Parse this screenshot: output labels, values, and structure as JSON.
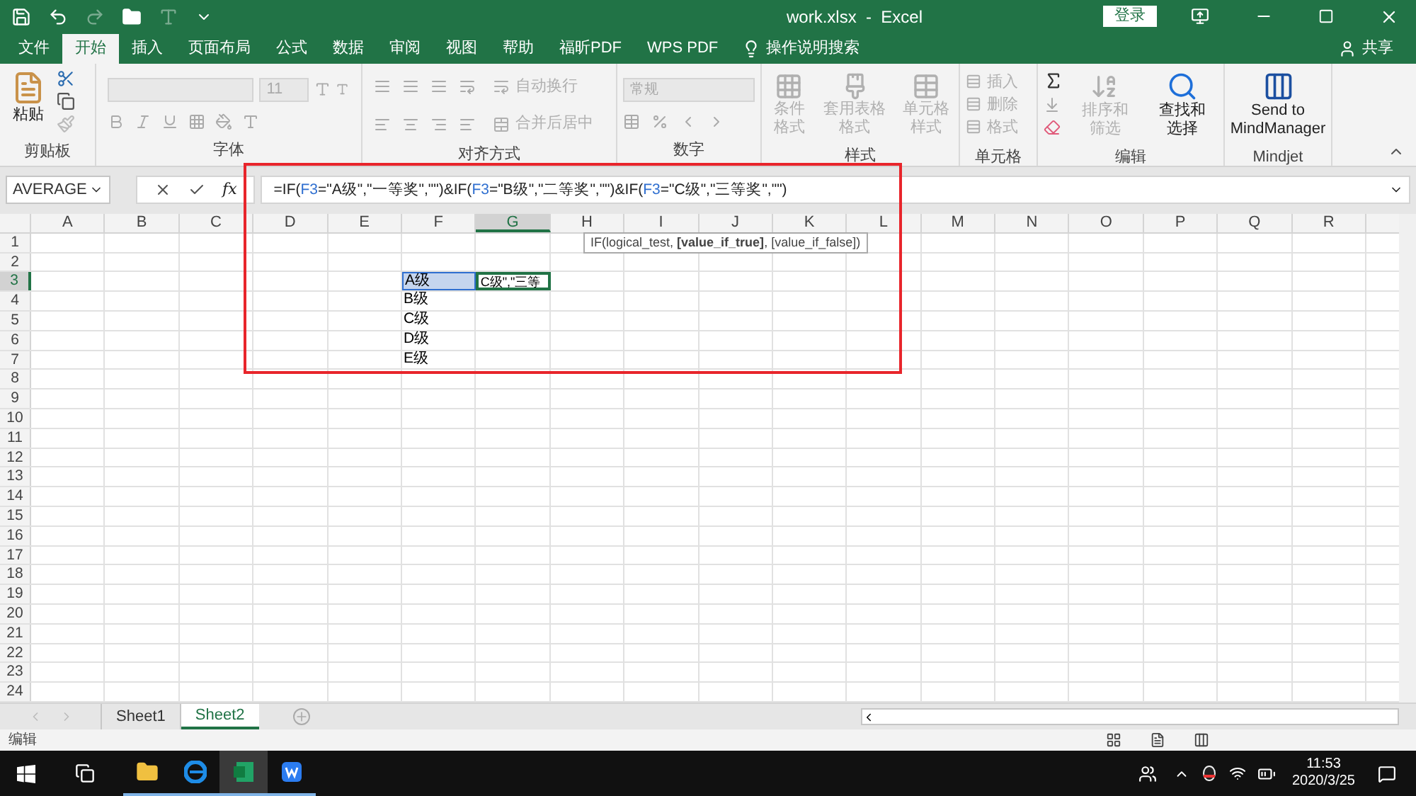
{
  "title_bar": {
    "title": "work.xlsx  -  Excel",
    "login": "登录"
  },
  "menu_tabs": [
    {
      "label": "文件",
      "selected": false
    },
    {
      "label": "开始",
      "selected": true
    },
    {
      "label": "插入",
      "selected": false
    },
    {
      "label": "页面布局",
      "selected": false
    },
    {
      "label": "公式",
      "selected": false
    },
    {
      "label": "数据",
      "selected": false
    },
    {
      "label": "审阅",
      "selected": false
    },
    {
      "label": "视图",
      "selected": false
    },
    {
      "label": "帮助",
      "selected": false
    },
    {
      "label": "福昕PDF",
      "selected": false
    },
    {
      "label": "WPS PDF",
      "selected": false
    }
  ],
  "tell_me": "操作说明搜索",
  "share": "共享",
  "ribbon": {
    "clipboard": {
      "label": "剪贴板",
      "paste": {
        "label": "粘贴",
        "disabled": false
      }
    },
    "font": {
      "label": "字体",
      "size": "11"
    },
    "alignment": {
      "label": "对齐方式",
      "commands": [
        {
          "label": "自动换行",
          "disabled": true
        },
        {
          "label": "合并后居中",
          "disabled": true
        }
      ]
    },
    "number": {
      "label": "数字",
      "format": "常规"
    },
    "styles": {
      "label": "样式",
      "commands": [
        {
          "label": "条件格式",
          "disabled": true
        },
        {
          "label": "套用表格格式",
          "disabled": true
        },
        {
          "label": "单元格样式",
          "disabled": true
        }
      ]
    },
    "cells": {
      "label": "单元格",
      "commands": [
        {
          "label": "插入",
          "disabled": true
        },
        {
          "label": "删除",
          "disabled": true
        },
        {
          "label": "格式",
          "disabled": true
        }
      ]
    },
    "editing": {
      "label": "编辑",
      "commands": [
        {
          "label": "排序和筛选",
          "disabled": true
        },
        {
          "label": "查找和选择",
          "disabled": false
        }
      ]
    },
    "mindjet": {
      "label": "Mindjet",
      "command": {
        "label": "Send to MindManager",
        "disabled": false
      }
    }
  },
  "formula_bar": {
    "name_box": "AVERAGE",
    "fx": "fx",
    "segments": [
      {
        "text": "=IF(",
        "kind": "text"
      },
      {
        "text": "F3",
        "kind": "ref"
      },
      {
        "text": "=\"A级\",\"一等奖\",\"\")&IF(",
        "kind": "text"
      },
      {
        "text": "F3",
        "kind": "ref"
      },
      {
        "text": "=\"B级\",\"二等奖\",\"\")&IF(",
        "kind": "text"
      },
      {
        "text": "F3",
        "kind": "ref"
      },
      {
        "text": "=\"C级\",\"三等奖\",\"\")",
        "kind": "text"
      }
    ]
  },
  "tooltip": "IF(logical_test, **[value_if_true]**, [value_if_false])",
  "sheet": {
    "columns": [
      {
        "label": "A",
        "selected": false
      },
      {
        "label": "B",
        "selected": false
      },
      {
        "label": "C",
        "selected": false
      },
      {
        "label": "D",
        "selected": false
      },
      {
        "label": "E",
        "selected": false
      },
      {
        "label": "F",
        "selected": false
      },
      {
        "label": "G",
        "selected": true
      },
      {
        "label": "H",
        "selected": false
      },
      {
        "label": "I",
        "selected": false
      },
      {
        "label": "J",
        "selected": false
      },
      {
        "label": "K",
        "selected": false
      },
      {
        "label": "L",
        "selected": false
      },
      {
        "label": "M",
        "selected": false
      },
      {
        "label": "N",
        "selected": false
      },
      {
        "label": "O",
        "selected": false
      },
      {
        "label": "P",
        "selected": false
      },
      {
        "label": "Q",
        "selected": false
      },
      {
        "label": "R",
        "selected": false
      }
    ],
    "rows": [
      {
        "label": "1",
        "selected": false
      },
      {
        "label": "2",
        "selected": false
      },
      {
        "label": "3",
        "selected": true,
        "cells": [
          {},
          {},
          {},
          {},
          {},
          {
            "text": "A级",
            "referenced": true
          },
          {
            "text": "C级\",\"三等",
            "editing": true
          }
        ]
      },
      {
        "label": "4",
        "selected": false,
        "cells": [
          {},
          {},
          {},
          {},
          {},
          {
            "text": "B级"
          }
        ]
      },
      {
        "label": "5",
        "selected": false,
        "cells": [
          {},
          {},
          {},
          {},
          {},
          {
            "text": "C级"
          }
        ]
      },
      {
        "label": "6",
        "selected": false,
        "cells": [
          {},
          {},
          {},
          {},
          {},
          {
            "text": "D级"
          }
        ]
      },
      {
        "label": "7",
        "selected": false,
        "cells": [
          {},
          {},
          {},
          {},
          {},
          {
            "text": "E级"
          }
        ]
      },
      {
        "label": "8",
        "selected": false
      },
      {
        "label": "9",
        "selected": false
      },
      {
        "label": "10",
        "selected": false
      },
      {
        "label": "11",
        "selected": false
      },
      {
        "label": "12",
        "selected": false
      },
      {
        "label": "13",
        "selected": false
      },
      {
        "label": "14",
        "selected": false
      },
      {
        "label": "15",
        "selected": false
      },
      {
        "label": "16",
        "selected": false
      },
      {
        "label": "17",
        "selected": false
      },
      {
        "label": "18",
        "selected": false
      },
      {
        "label": "19",
        "selected": false
      },
      {
        "label": "20",
        "selected": false
      },
      {
        "label": "21",
        "selected": false
      },
      {
        "label": "22",
        "selected": false
      },
      {
        "label": "23",
        "selected": false
      },
      {
        "label": "24",
        "selected": false
      }
    ]
  },
  "sheet_tabs": [
    {
      "label": "Sheet1",
      "selected": false
    },
    {
      "label": "Sheet2",
      "selected": true
    }
  ],
  "status_bar": {
    "mode": "编辑"
  },
  "taskbar": {
    "time": "11:53",
    "date": "2020/3/25",
    "apps": [
      {
        "kind": "explorer",
        "active": false
      },
      {
        "kind": "edge",
        "active": false
      },
      {
        "kind": "excel",
        "active": true
      },
      {
        "kind": "wps",
        "active": false
      }
    ]
  }
}
